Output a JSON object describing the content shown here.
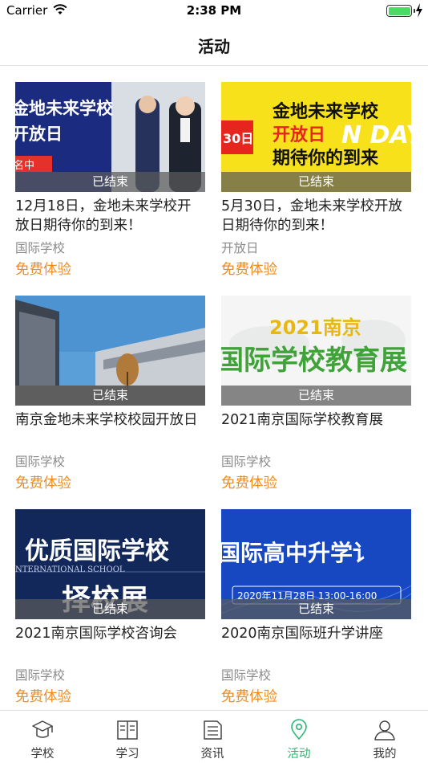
{
  "status_bar": {
    "carrier": "Carrier",
    "time": "2:38 PM"
  },
  "nav": {
    "title": "活动"
  },
  "colors": {
    "accent": "#2bb673",
    "price": "#f08c1e",
    "muted": "#8a8a8a"
  },
  "events": [
    {
      "title": "12月18日，金地未来学校开放日期待你的到来！",
      "category": "国际学校",
      "price": "免费体验",
      "status": "已结束",
      "banner": [
        "金地未来学校",
        "开放日",
        "名中"
      ]
    },
    {
      "title": "5月30日，金地未来学校开放日期待你的到来！",
      "category": "开放日",
      "price": "免费体验",
      "status": "已结束",
      "banner": [
        "金地未来学校",
        "开放日",
        "期待你的到来",
        "30日",
        "N DAY"
      ]
    },
    {
      "title": "南京金地未来学校校园开放日",
      "category": "国际学校",
      "price": "免费体验",
      "status": "已结束",
      "banner": []
    },
    {
      "title": "2021南京国际学校教育展",
      "category": "国际学校",
      "price": "免费体验",
      "status": "已结束",
      "banner": [
        "2021南京",
        "国际学校教育展"
      ]
    },
    {
      "title": "2021南京国际学校咨询会",
      "category": "国际学校",
      "price": "免费体验",
      "status": "已结束",
      "banner": [
        "优质国际学校",
        "NTERNATIONAL SCHOOL",
        "择校展"
      ]
    },
    {
      "title": "2020南京国际班升学讲座",
      "category": "国际学校",
      "price": "免费体验",
      "status": "已结束",
      "banner": [
        "国际高中升学讠",
        "2020年11月28日 13:00-16:00"
      ]
    }
  ],
  "tabs": [
    {
      "label": "学校",
      "icon": "graduation-cap-icon",
      "active": false
    },
    {
      "label": "学习",
      "icon": "book-icon",
      "active": false
    },
    {
      "label": "资讯",
      "icon": "news-icon",
      "active": false
    },
    {
      "label": "活动",
      "icon": "location-pin-icon",
      "active": true
    },
    {
      "label": "我的",
      "icon": "user-icon",
      "active": false
    }
  ]
}
